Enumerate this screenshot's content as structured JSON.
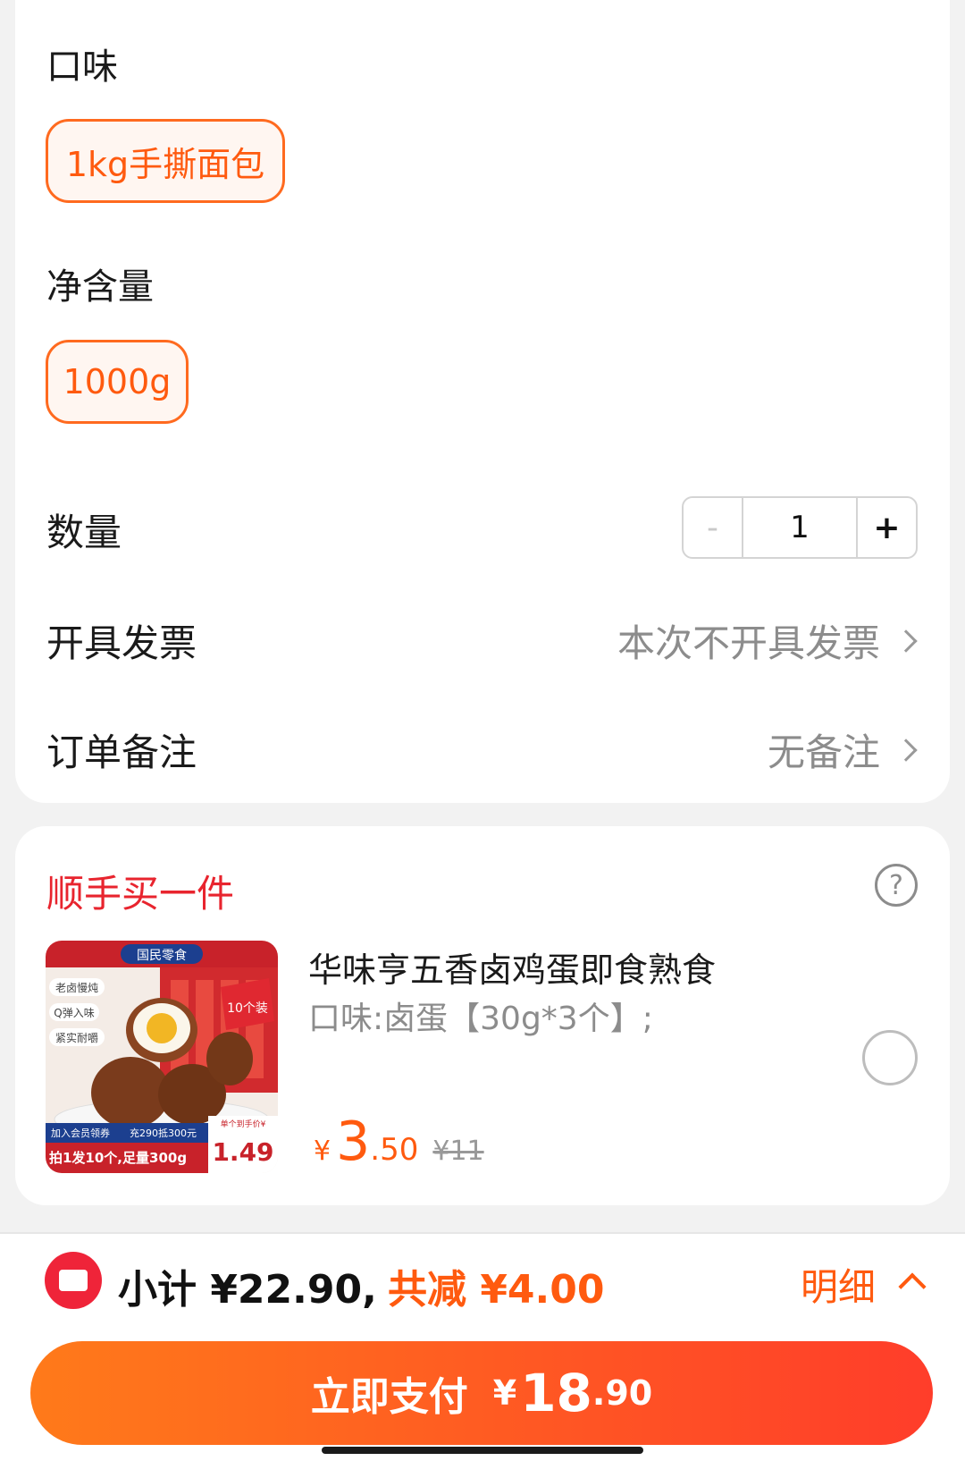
{
  "options": {
    "flavor": {
      "label": "口味",
      "selected": "1kg手撕面包"
    },
    "weight": {
      "label": "净含量",
      "selected": "1000g"
    }
  },
  "quantity": {
    "label": "数量",
    "minus": "-",
    "value": "1",
    "plus": "+"
  },
  "invoice": {
    "label": "开具发票",
    "value": "本次不开具发票"
  },
  "note": {
    "label": "订单备注",
    "value": "无备注"
  },
  "addon": {
    "title": "顺手买一件",
    "help_icon": "?",
    "product": {
      "name": "华味亨五香卤鸡蛋即食熟食",
      "spec": "口味:卤蛋【30g*3个】;",
      "price_symbol": "¥",
      "price_int": "3",
      "price_dec": ".50",
      "original_price": "¥11",
      "image_texts": {
        "brand": "国民零食",
        "tag1": "老卤慢炖",
        "tag2": "Q弹入味",
        "tag3": "紧实耐嚼",
        "badge": "10个装",
        "promo1": "加入会员领券",
        "promo2": "充290抵300元",
        "bottom": "拍1发10个,足量300g",
        "unit_price_label": "单个到手价¥",
        "unit_price": "1.49"
      }
    }
  },
  "summary": {
    "subtotal": "小计 ¥22.90,",
    "discount": "共减 ¥4.00",
    "detail": "明细"
  },
  "pay": {
    "label": "立即支付",
    "symbol": "¥",
    "int": "18",
    "dec": ".90"
  },
  "colors": {
    "accent": "#ff5a0f",
    "red": "#e8242e",
    "border": "#ff6a1f"
  }
}
